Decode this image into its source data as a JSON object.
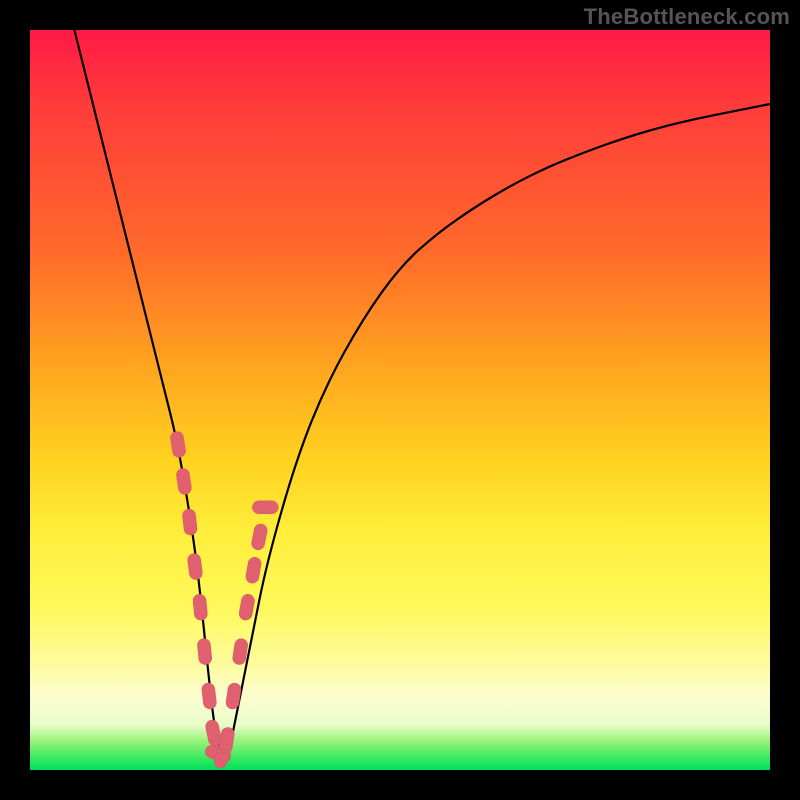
{
  "watermark": "TheBottleneck.com",
  "colors": {
    "frame": "#000000",
    "gradient_top": "#ff1a44",
    "gradient_mid": "#ffd21f",
    "gradient_bottom": "#00e060",
    "curve": "#000000",
    "marker": "#e06070"
  },
  "chart_data": {
    "type": "line",
    "title": "",
    "xlabel": "",
    "ylabel": "",
    "xlim": [
      0,
      100
    ],
    "ylim": [
      0,
      100
    ],
    "grid": false,
    "legend": false,
    "series": [
      {
        "name": "bottleneck-curve",
        "x": [
          6,
          8,
          10,
          12,
          14,
          16,
          18,
          20,
          22,
          23,
          24,
          25,
          26,
          27,
          28,
          30,
          32,
          36,
          40,
          45,
          50,
          55,
          60,
          65,
          70,
          75,
          80,
          85,
          90,
          95,
          100
        ],
        "values": [
          100,
          92,
          84,
          76,
          68,
          60,
          52,
          44,
          32,
          24,
          14,
          5,
          2,
          3,
          8,
          18,
          28,
          42,
          52,
          61,
          68,
          72.5,
          76,
          79,
          81.5,
          83.5,
          85.3,
          86.8,
          88,
          89,
          90
        ]
      }
    ],
    "markers": {
      "name": "highlighted-points",
      "shape": "rounded-pill",
      "x": [
        20.0,
        20.8,
        21.6,
        22.3,
        23.0,
        23.6,
        24.2,
        24.8,
        25.4,
        26.0,
        26.6,
        27.5,
        28.4,
        29.3,
        30.2,
        31.0,
        31.8
      ],
      "values": [
        44.0,
        39.0,
        33.5,
        27.5,
        22.0,
        16.0,
        10.0,
        5.0,
        2.2,
        2.0,
        4.0,
        10.0,
        16.0,
        22.0,
        27.0,
        31.5,
        35.5
      ]
    }
  }
}
